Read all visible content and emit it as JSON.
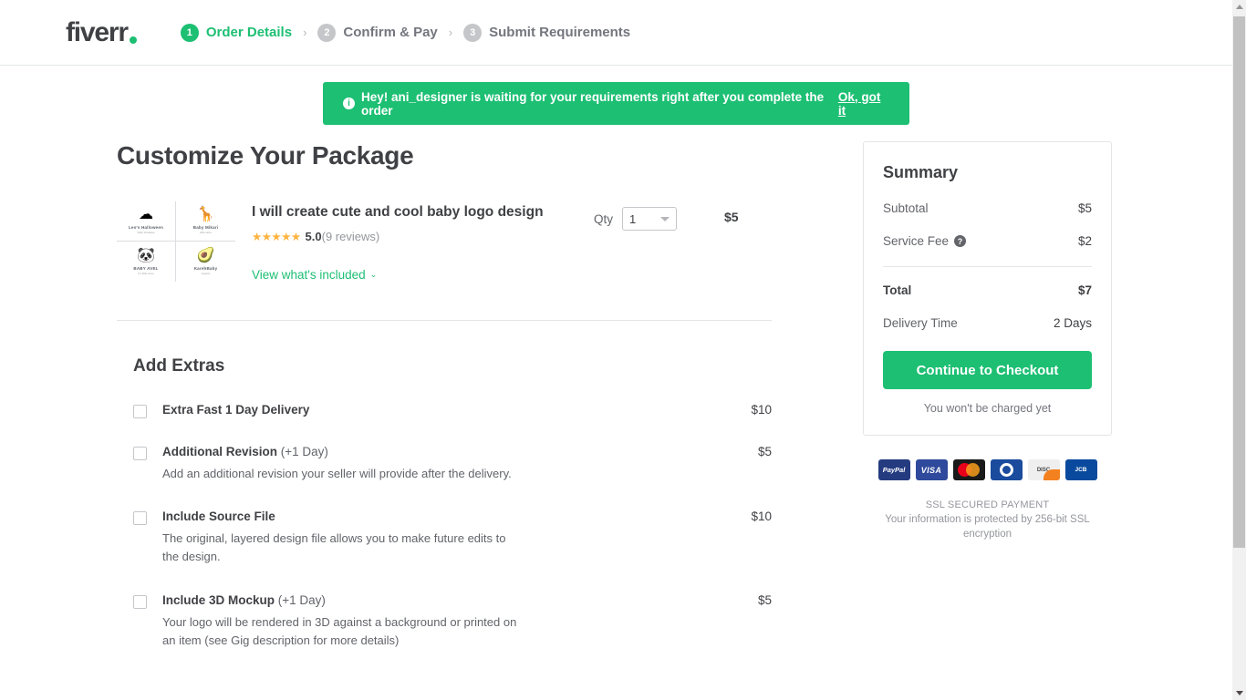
{
  "brand": {
    "logo_text": "fiverr",
    "accent_color": "#1dbf73",
    "dot_color": "#1dbf73"
  },
  "header": {
    "steps": [
      {
        "number": "1",
        "label": "Order Details",
        "state": "active"
      },
      {
        "number": "2",
        "label": "Confirm & Pay",
        "state": "inactive"
      },
      {
        "number": "3",
        "label": "Submit Requirements",
        "state": "inactive"
      }
    ],
    "separator": "›"
  },
  "banner": {
    "icon": "info-icon",
    "icon_glyph": "i",
    "message": "Hey! ani_designer is waiting for your requirements right after you complete the order",
    "action_label": "Ok, got it",
    "background_color": "#1dbf73"
  },
  "main": {
    "page_title": "Customize Your Package",
    "gig": {
      "title": "I will create cute and cool baby logo design",
      "stars": "★★★★★",
      "rating": "5.0",
      "reviews": "(9 reviews)",
      "included_link": "View what's included",
      "chevron": "⌄",
      "qty_label": "Qty",
      "qty_value": "1",
      "price": "$5",
      "thumbnail_logos": [
        {
          "mark": "☁",
          "name": "Leo's Halloween",
          "sub": "baby boutique"
        },
        {
          "mark": "🦒",
          "name": "Baby Mikari",
          "sub": "kids store"
        },
        {
          "mark": "🐼",
          "name": "BABY AVEL",
          "sub": "for little ones"
        },
        {
          "mark": "🥑",
          "name": "KarehBaby",
          "sub": "organic"
        }
      ]
    },
    "extras_title": "Add Extras",
    "extras": [
      {
        "name": "Extra Fast 1 Day Delivery",
        "note": "",
        "description": "",
        "price": "$10",
        "checked": false
      },
      {
        "name": "Additional Revision",
        "note": " (+1 Day)",
        "description": "Add an additional revision your seller will provide after the delivery.",
        "price": "$5",
        "checked": false
      },
      {
        "name": "Include Source File",
        "note": "",
        "description": "The original, layered design file allows you to make future edits to the design.",
        "price": "$10",
        "checked": false
      },
      {
        "name": "Include 3D Mockup",
        "note": " (+1 Day)",
        "description": "Your logo will be rendered in 3D against a background or printed on an item (see Gig description for more details)",
        "price": "$5",
        "checked": false
      }
    ]
  },
  "summary": {
    "title": "Summary",
    "subtotal_label": "Subtotal",
    "subtotal_value": "$5",
    "service_fee_label": "Service Fee",
    "service_fee_help": "?",
    "service_fee_value": "$2",
    "total_label": "Total",
    "total_value": "$7",
    "delivery_label": "Delivery Time",
    "delivery_value": "2 Days",
    "checkout_button": "Continue to Checkout",
    "charge_note": "You won't be charged yet"
  },
  "payment": {
    "methods": [
      {
        "id": "paypal",
        "label": "PayPal"
      },
      {
        "id": "visa",
        "label": "VISA"
      },
      {
        "id": "mastercard",
        "label": ""
      },
      {
        "id": "diners",
        "label": ""
      },
      {
        "id": "discover",
        "label": "DISC"
      },
      {
        "id": "jcb",
        "label": "JCB"
      }
    ],
    "ssl_title": "SSL SECURED PAYMENT",
    "ssl_note": "Your information is protected by 256-bit SSL encryption"
  }
}
